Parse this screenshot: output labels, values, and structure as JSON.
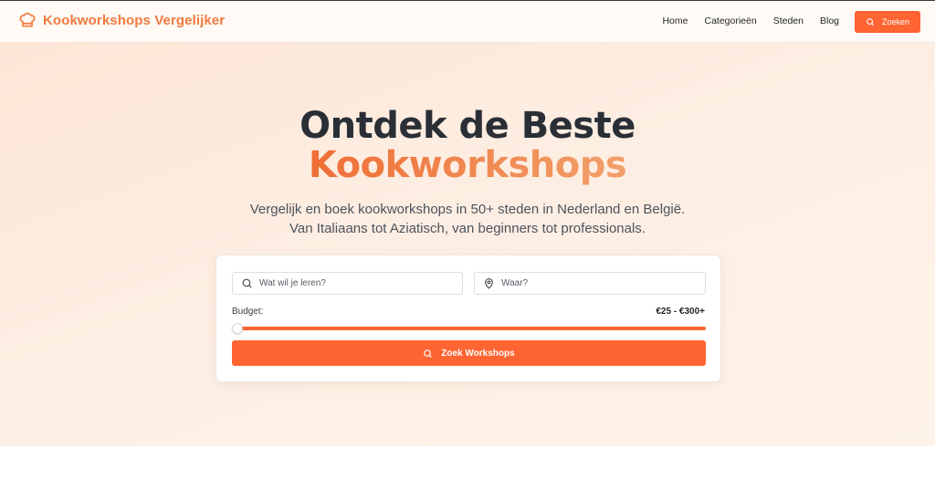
{
  "brand": {
    "name": "Kookworkshops Vergelijker",
    "icon": "chef-hat-icon",
    "color": "#f07a3e"
  },
  "nav": {
    "items": [
      {
        "label": "Home"
      },
      {
        "label": "Categorieën"
      },
      {
        "label": "Steden"
      },
      {
        "label": "Blog"
      }
    ],
    "cta_label": "Zoeken",
    "cta_icon": "search-icon"
  },
  "hero": {
    "title_line1": "Ontdek de Beste",
    "title_line2": "Kookworkshops",
    "subtitle": "Vergelijk en boek kookworkshops in 50+ steden in Nederland en België. Van Italiaans tot Aziatisch, van beginners tot professionals."
  },
  "search": {
    "what_placeholder": "Wat wil je leren?",
    "what_icon": "search-icon",
    "where_placeholder": "Waar?",
    "where_icon": "map-pin-icon",
    "budget_label": "Budget:",
    "budget_value": "€25 - €300+",
    "button_label": "Zoek Workshops",
    "button_icon": "search-icon"
  },
  "colors": {
    "accent": "#ff6433",
    "text_dark": "#2a2f36"
  }
}
